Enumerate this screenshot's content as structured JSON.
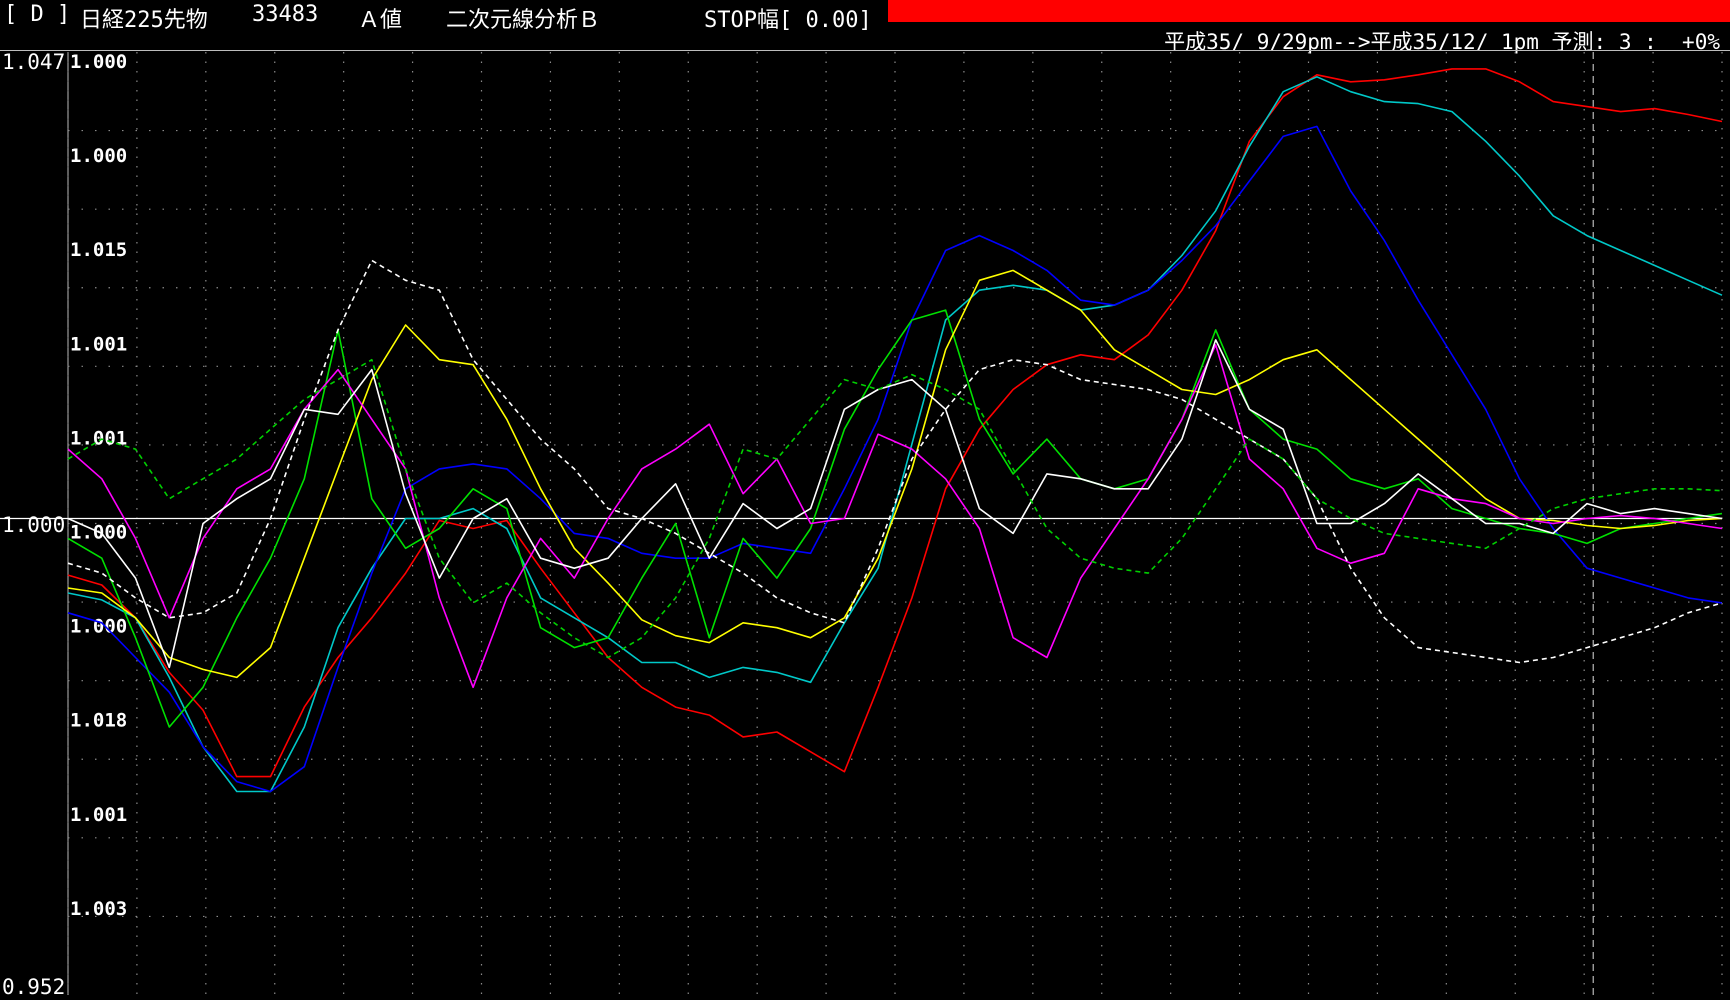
{
  "header": {
    "symbol_tag": "[ D ]",
    "instrument": "日経225先物",
    "code": "33483",
    "value_type": "Ａ値",
    "analysis": "二次元線分析Ｂ",
    "stop_width": "STOP幅[ 0.00]",
    "period_text": "平成35/ 9/29pm-->平成35/12/ 1pm 予測: 3 :  +0%",
    "stop_bar_color": "#ff0000"
  },
  "chart_data": {
    "type": "line",
    "title": "",
    "y_axis_labels": {
      "top": "1.047",
      "middle": "1.000",
      "bottom": "0.952"
    },
    "ylim": [
      0.952,
      1.047
    ],
    "baseline": 1.0,
    "inner_labels": [
      "1.000",
      "1.000",
      "1.015",
      "1.001",
      "1.001",
      "1.000",
      "1.000",
      "1.018",
      "1.001",
      "1.003"
    ],
    "x": [
      0,
      1,
      2,
      3,
      4,
      5,
      6,
      7,
      8,
      9,
      10,
      11,
      12,
      13,
      14,
      15,
      16,
      17,
      18,
      19,
      20,
      21,
      22,
      23,
      24,
      25,
      26,
      27,
      28,
      29,
      30,
      31,
      32,
      33,
      34,
      35,
      36,
      37,
      38,
      39,
      40,
      41,
      42,
      43,
      44,
      45,
      46,
      47,
      48,
      49
    ],
    "grid": true,
    "forecast_start_index": 44,
    "series": [
      {
        "color": "#ff0000",
        "dash": false,
        "values": [
          0.9943,
          0.9933,
          0.99,
          0.9845,
          0.9807,
          0.974,
          0.974,
          0.981,
          0.986,
          0.99,
          0.9945,
          0.9998,
          0.999,
          0.9998,
          0.995,
          0.9905,
          0.986,
          0.983,
          0.981,
          0.9802,
          0.978,
          0.9785,
          0.9765,
          0.9745,
          0.983,
          0.992,
          1.003,
          1.009,
          1.013,
          1.0155,
          1.0165,
          1.016,
          1.0185,
          1.023,
          1.029,
          1.038,
          1.0425,
          1.0447,
          1.044,
          1.0442,
          1.0447,
          1.0453,
          1.0453,
          1.044,
          1.042,
          1.0415,
          1.041,
          1.0413,
          1.0407,
          1.04
        ]
      },
      {
        "color": "#00c8c8",
        "dash": false,
        "values": [
          0.9925,
          0.9918,
          0.99,
          0.984,
          0.977,
          0.9725,
          0.9725,
          0.979,
          0.989,
          0.995,
          1.0,
          1.0,
          1.001,
          0.999,
          0.992,
          0.99,
          0.988,
          0.9855,
          0.9855,
          0.984,
          0.985,
          0.9845,
          0.9835,
          0.9895,
          0.995,
          1.0075,
          1.02,
          1.023,
          1.0235,
          1.023,
          1.021,
          1.0215,
          1.023,
          1.0265,
          1.031,
          1.0375,
          1.043,
          1.0445,
          1.043,
          1.042,
          1.0418,
          1.041,
          1.038,
          1.0345,
          1.0305,
          1.0285,
          1.027,
          1.0255,
          1.024,
          1.0225
        ]
      },
      {
        "color": "#0000ff",
        "dash": false,
        "values": [
          0.9905,
          0.9895,
          0.986,
          0.9825,
          0.977,
          0.9735,
          0.9725,
          0.975,
          0.985,
          0.9945,
          1.003,
          1.005,
          1.0055,
          1.005,
          1.002,
          0.9985,
          0.998,
          0.9965,
          0.996,
          0.996,
          0.9975,
          0.997,
          0.9965,
          1.003,
          1.01,
          1.02,
          1.027,
          1.0285,
          1.027,
          1.025,
          1.022,
          1.0215,
          1.023,
          1.026,
          1.0295,
          1.034,
          1.0385,
          1.0395,
          1.033,
          1.028,
          1.022,
          1.0165,
          1.011,
          1.004,
          0.999,
          0.995,
          0.994,
          0.993,
          0.992,
          0.9915
        ]
      },
      {
        "color": "#00e000",
        "dash": false,
        "values": [
          0.998,
          0.996,
          0.988,
          0.979,
          0.983,
          0.99,
          0.996,
          1.004,
          1.019,
          1.002,
          0.997,
          0.999,
          1.003,
          1.001,
          0.989,
          0.987,
          0.988,
          0.994,
          0.9995,
          0.988,
          0.998,
          0.994,
          0.999,
          1.009,
          1.015,
          1.02,
          1.021,
          1.01,
          1.0045,
          1.008,
          1.004,
          1.003,
          1.004,
          1.01,
          1.019,
          1.011,
          1.008,
          1.007,
          1.004,
          1.003,
          1.004,
          1.001,
          1.0,
          0.999,
          0.9985,
          0.9975,
          0.999,
          0.9995,
          1.0,
          1.0005
        ]
      },
      {
        "color": "#ffff00",
        "dash": false,
        "values": [
          0.993,
          0.9925,
          0.99,
          0.986,
          0.9848,
          0.984,
          0.987,
          0.996,
          1.005,
          1.014,
          1.0195,
          1.016,
          1.0155,
          1.01,
          1.003,
          0.997,
          0.9935,
          0.9898,
          0.9882,
          0.9875,
          0.9895,
          0.989,
          0.988,
          0.99,
          0.996,
          1.005,
          1.017,
          1.024,
          1.025,
          1.023,
          1.021,
          1.017,
          1.015,
          1.013,
          1.0125,
          1.014,
          1.016,
          1.017,
          1.014,
          1.011,
          1.008,
          1.005,
          1.002,
          1.0,
          0.9998,
          0.9993,
          0.999,
          0.9993,
          0.9998,
          1.0
        ]
      },
      {
        "color": "#ff00ff",
        "dash": false,
        "values": [
          1.007,
          1.004,
          0.998,
          0.99,
          0.998,
          1.003,
          1.005,
          1.011,
          1.015,
          1.01,
          1.005,
          0.992,
          0.983,
          0.992,
          0.998,
          0.994,
          1.0,
          1.005,
          1.007,
          1.0095,
          1.0025,
          1.006,
          0.9995,
          1.0,
          1.0085,
          1.007,
          1.004,
          0.999,
          0.988,
          0.986,
          0.994,
          0.999,
          1.004,
          1.01,
          1.0175,
          1.006,
          1.003,
          0.997,
          0.9955,
          0.9965,
          1.003,
          1.002,
          1.0015,
          1.0,
          0.9995,
          1.0,
          1.0003,
          1.0,
          0.9995,
          0.999
        ]
      },
      {
        "color": "#ffffff",
        "dash": false,
        "values": [
          1.0,
          0.9985,
          0.994,
          0.985,
          0.9995,
          1.002,
          1.004,
          1.011,
          1.0105,
          1.015,
          1.0025,
          0.994,
          1.0,
          1.002,
          0.996,
          0.995,
          0.996,
          1.0,
          1.0035,
          0.996,
          1.0015,
          0.999,
          1.001,
          1.011,
          1.013,
          1.014,
          1.011,
          1.001,
          0.9985,
          1.0045,
          1.004,
          1.003,
          1.003,
          1.008,
          1.018,
          1.011,
          1.009,
          0.9995,
          0.9995,
          1.0015,
          1.0045,
          1.002,
          0.9995,
          0.9995,
          0.9985,
          1.0015,
          1.0005,
          1.001,
          1.0005,
          1.0
        ]
      },
      {
        "color": "#ffffff",
        "dash": true,
        "values": [
          0.9955,
          0.9945,
          0.992,
          0.99,
          0.9905,
          0.9925,
          1.0,
          1.01,
          1.019,
          1.026,
          1.024,
          1.023,
          1.016,
          1.012,
          1.008,
          1.005,
          1.001,
          1.0,
          0.9985,
          0.9965,
          0.9945,
          0.992,
          0.9905,
          0.9895,
          0.997,
          1.006,
          1.011,
          1.015,
          1.016,
          1.0155,
          1.014,
          1.0135,
          1.013,
          1.012,
          1.01,
          1.008,
          1.006,
          1.002,
          0.995,
          0.99,
          0.987,
          0.9865,
          0.986,
          0.9855,
          0.986,
          0.987,
          0.988,
          0.989,
          0.9905,
          0.9915
        ]
      },
      {
        "color": "#00d000",
        "dash": true,
        "values": [
          1.006,
          1.008,
          1.007,
          1.002,
          1.004,
          1.006,
          1.009,
          1.012,
          1.014,
          1.016,
          1.005,
          0.996,
          0.9915,
          0.9935,
          0.9905,
          0.988,
          0.986,
          0.988,
          0.992,
          0.998,
          1.007,
          1.006,
          1.01,
          1.014,
          1.013,
          1.0145,
          1.013,
          1.011,
          1.005,
          0.999,
          0.996,
          0.995,
          0.9945,
          0.998,
          1.003,
          1.008,
          1.006,
          1.002,
          1.0,
          0.9985,
          0.998,
          0.9975,
          0.997,
          0.999,
          1.001,
          1.002,
          1.0025,
          1.003,
          1.003,
          1.0028
        ]
      }
    ]
  }
}
